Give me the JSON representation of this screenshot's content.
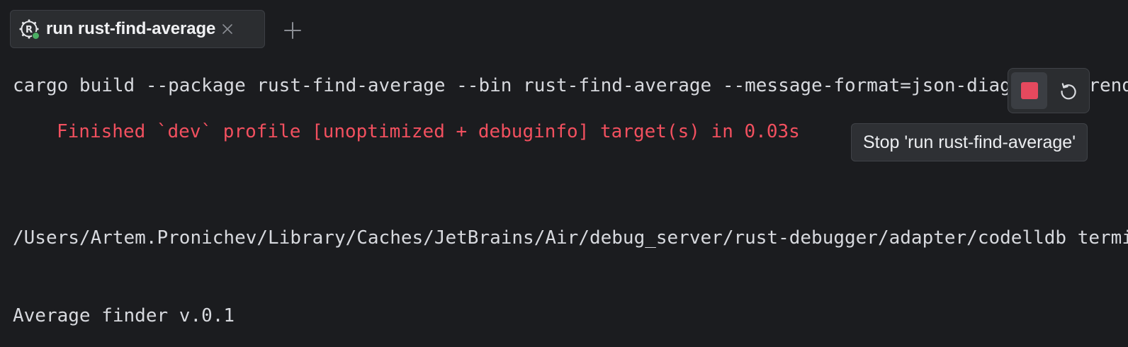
{
  "tab": {
    "icon": "rust-icon",
    "label": "run rust-find-average",
    "close_icon": "close-icon",
    "status_color": "#4caf64"
  },
  "add_tab_icon": "plus-icon",
  "terminal": {
    "lines": [
      "cargo build --package rust-find-average --bin rust-find-average --message-format=json-diagnostic-rendered-ansi",
      "Finished `dev` profile [unoptimized + debuginfo] target(s) in 0.03s",
      "/Users/Artem.Pronichev/Library/Caches/JetBrains/Air/debug_server/rust-debugger/adapter/codelldb terminal-agent",
      "Average finder v.0.1"
    ],
    "finished_color": "#f2505f"
  },
  "controls": {
    "stop_icon": "stop-icon",
    "stop_color": "#e5495e",
    "rerun_icon": "rerun-icon"
  },
  "tooltip": {
    "text": "Stop 'run rust-find-average'"
  }
}
